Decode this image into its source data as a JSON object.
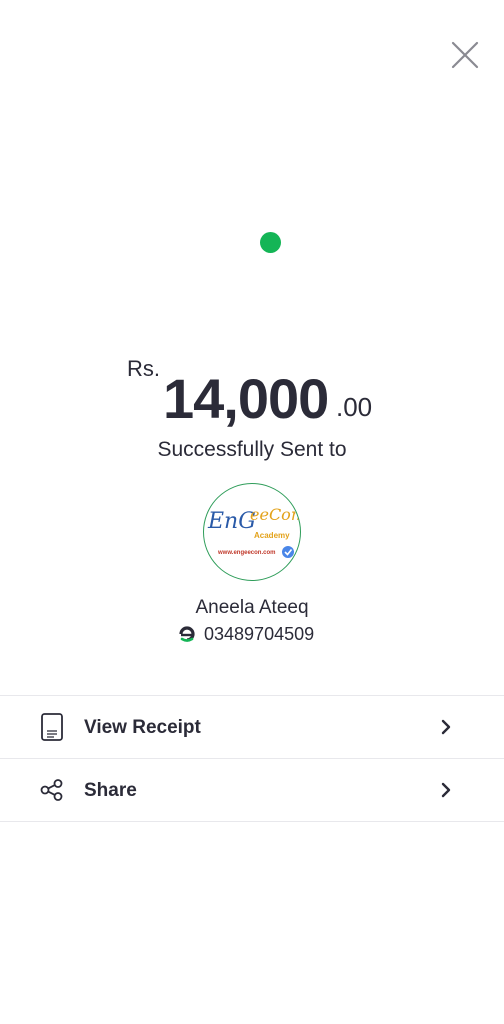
{
  "header": {
    "close_icon": "close-icon"
  },
  "status": {
    "indicator_color": "#14b556"
  },
  "amount": {
    "currency": "Rs.",
    "whole": "14,000",
    "decimal": ".00"
  },
  "status_text": "Successfully Sent to",
  "recipient": {
    "avatar_logo_text": "EnGeeCon",
    "avatar_logo_sub": "Academy",
    "avatar_logo_url": "www.engeecon.com",
    "name": "Aneela Ateeq",
    "wallet_icon": "easypaisa-icon",
    "phone": "03489704509"
  },
  "actions": [
    {
      "label": "View Receipt",
      "icon": "receipt-icon"
    },
    {
      "label": "Share",
      "icon": "share-icon"
    }
  ],
  "colors": {
    "brand_green": "#14b556",
    "text": "#2b2b38",
    "divider": "#e8e8ec"
  }
}
